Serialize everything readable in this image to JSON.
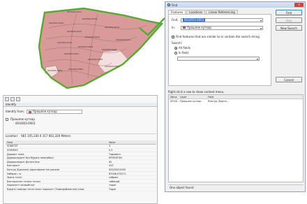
{
  "map": {
    "parcel_labels": [
      "003/003-0017",
      "003/003-0016",
      "003/003-0015",
      "003/003-0014",
      "003/003-0013",
      "003/003-0012",
      "003/003-0011",
      "003/003-0010",
      "003/003-0009",
      "003/003-0008",
      "003/003-0007",
      "003/003-0006",
      "003/003-0005",
      "003/003-0004",
      "003/003-0003"
    ],
    "colors": {
      "parcel_fill": "#d99a9a",
      "parcel_highlight": "#f4dede",
      "selection_outline": "#58a832",
      "contour": "#8c5a5a"
    }
  },
  "identify": {
    "title": "Identify",
    "from_label": "Identify from:",
    "from_value": "Прошлое кутхар",
    "layer_node": "Прошлое кутхар",
    "feature_node": "003/003-0003",
    "location_label": "Location:",
    "location_value": "661 105,330  4 317 661,326 Meters",
    "table_headers": [
      "Field",
      "Value"
    ],
    "rows": [
      {
        "field": "SONETET",
        "value": "3"
      },
      {
        "field": "ЭЭЛЖЭЭ",
        "value": "0,5"
      },
      {
        "field": "Дарааст нэмэ",
        "value": "Тэдмаатэ"
      },
      {
        "field": "Дарааллэдэлт бүл бӯдэнэ нэмс(ябох)",
        "value": "ИТНЭЭТЭН"
      },
      {
        "field": "Дарааллэдэлт Дэтэнэ ёна",
        "value": "00"
      },
      {
        "field": "Бэлтэрэлт",
        "value": "415"
      },
      {
        "field": "Контур (Бдэнэнэ) харатэфэкагтэн рэкэнм",
        "value": "003/003-0003"
      },
      {
        "field": "Нэбэрэн, гэ",
        "value": "87006,073271"
      },
      {
        "field": "Эрэнь тэтэн",
        "value": "собрам"
      },
      {
        "field": "Бэлтэрэлтэн тэтэнэ тэтэнэ",
        "value": "табаный"
      },
      {
        "field": "Хэдээлэтт хёлоайтэлт",
        "value": "тэдэн"
      },
      {
        "field": "Бэдэнэ тавэндэ тэтэн энэлт хэдээлэт (Тавэндэбэкагэнэ) нэмэ",
        "value": "Тэдэн"
      }
    ]
  },
  "find": {
    "title": "Find",
    "close_glyph": "✕",
    "tabs": [
      "Features",
      "Locations",
      "Linear Referencing"
    ],
    "find_label": "Find:",
    "find_value": "003/003-0003",
    "in_label": "In:",
    "in_value": "Прошлое кутхар",
    "similar_label": "Find features that are similar to or contain the search string",
    "search_label": "Search:",
    "all_fields": "All fields",
    "in_field": "In field:",
    "buttons": {
      "find": "Find",
      "stop": "Stop",
      "new_search": "New Search",
      "cancel": "Cancel"
    },
    "hint": "Right-click a row to show context menu.",
    "result_headers": [
      "Value",
      "Layer",
      "Field"
    ],
    "results": [
      {
        "value": "003/0...",
        "layer": "Прошлое кутхар",
        "field": "Контур (Бдэнэ..."
      }
    ],
    "status": "One object found"
  }
}
